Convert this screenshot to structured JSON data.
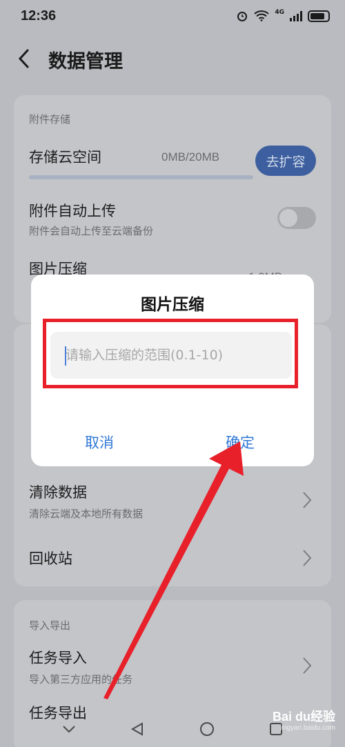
{
  "status_bar": {
    "time": "12:36",
    "network": "4G"
  },
  "header": {
    "title": "数据管理"
  },
  "attachment_section": {
    "label": "附件存储",
    "cloud_storage": {
      "title": "存储云空间",
      "usage": "0MB/20MB",
      "expand_label": "去扩容",
      "usage_fraction": 0
    },
    "auto_upload": {
      "title": "附件自动上传",
      "subtitle": "附件会自动上传至云端备份"
    },
    "image_compress": {
      "title": "图片压缩",
      "value": "1.0MB"
    }
  },
  "data_section": {
    "clear_data": {
      "title": "清除数据",
      "subtitle": "清除云端及本地所有数据"
    },
    "recycle_bin": {
      "title": "回收站"
    }
  },
  "import_export_section": {
    "label": "导入导出",
    "task_import": {
      "title": "任务导入",
      "subtitle": "导入第三方应用的任务"
    },
    "task_export": {
      "title": "任务导出"
    }
  },
  "dialog": {
    "title": "图片压缩",
    "input_placeholder": "请输入压缩的范围(0.1-10)",
    "input_value": "",
    "cancel_label": "取消",
    "confirm_label": "确定"
  },
  "watermark": {
    "brand": "Bai du经验",
    "url": "jingyan.baidu.com"
  },
  "colors": {
    "accent": "#2f78d6",
    "highlight": "#e8202a",
    "expand_button": "#3d5f9f"
  }
}
